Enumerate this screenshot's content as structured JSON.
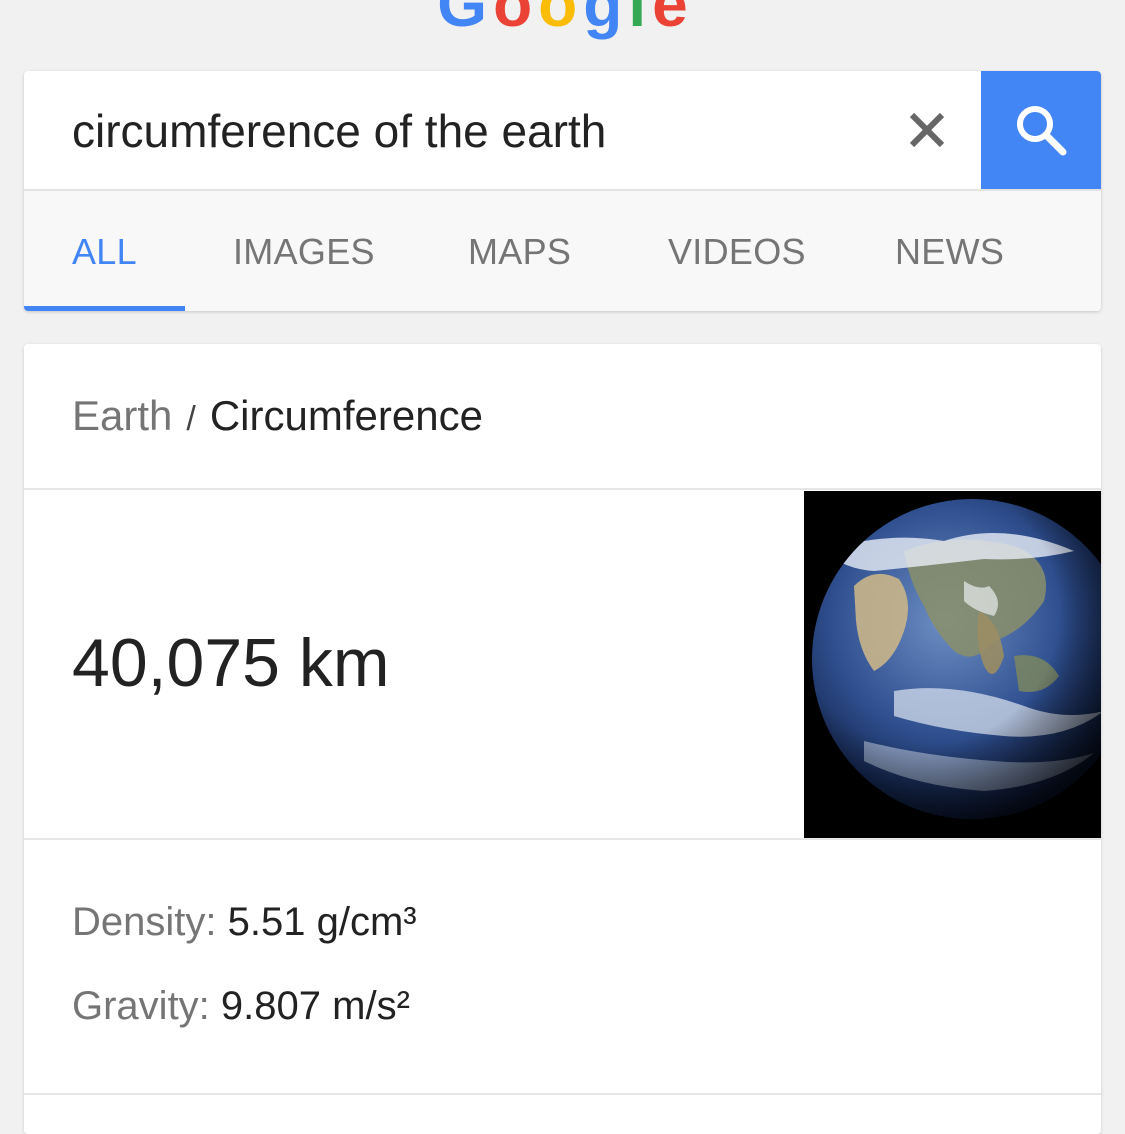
{
  "logo": {
    "letters": [
      {
        "char": "G",
        "color": "#4285f4"
      },
      {
        "char": "o",
        "color": "#ea4335"
      },
      {
        "char": "o",
        "color": "#fbbc05"
      },
      {
        "char": "g",
        "color": "#4285f4"
      },
      {
        "char": "l",
        "color": "#34a853"
      },
      {
        "char": "e",
        "color": "#ea4335"
      }
    ]
  },
  "search": {
    "query": "circumference of the earth",
    "clear_icon": "close-icon",
    "search_icon": "magnifier-icon",
    "accent_color": "#4285f4"
  },
  "tabs": [
    {
      "label": "ALL",
      "active": true
    },
    {
      "label": "IMAGES",
      "active": false
    },
    {
      "label": "MAPS",
      "active": false
    },
    {
      "label": "VIDEOS",
      "active": false
    },
    {
      "label": "NEWS",
      "active": false
    }
  ],
  "result": {
    "breadcrumb_parent": "Earth",
    "breadcrumb_separator": "/",
    "breadcrumb_current": "Circumference",
    "answer": "40,075 km",
    "image_alt": "earth-globe-photo",
    "facts": [
      {
        "label": "Density:",
        "value": "5.51 g/cm³"
      },
      {
        "label": "Gravity:",
        "value": "9.807 m/s²"
      }
    ]
  }
}
